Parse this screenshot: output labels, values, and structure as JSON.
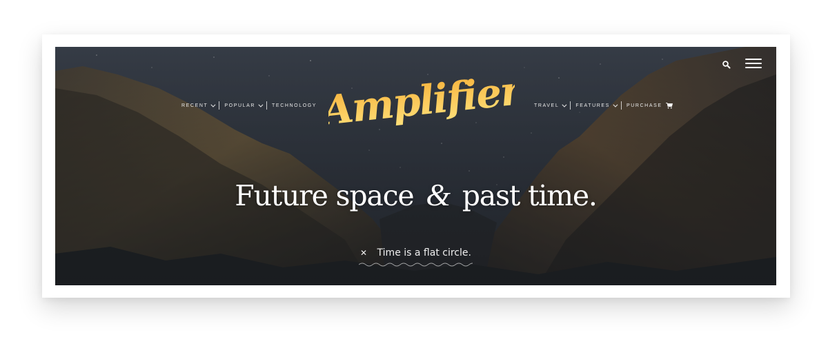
{
  "brand": {
    "logo_text": "Amplifier",
    "colors": {
      "logo_top": "#f6b13a",
      "logo_bottom": "#ffe07a"
    }
  },
  "nav_left": [
    {
      "label": "Recent",
      "dropdown": true
    },
    {
      "label": "Popular",
      "dropdown": true
    },
    {
      "label": "Technology",
      "dropdown": false
    }
  ],
  "nav_right": [
    {
      "label": "Travel",
      "dropdown": true
    },
    {
      "label": "Features",
      "dropdown": true
    },
    {
      "label": "Purchase",
      "icon": "cart-icon"
    }
  ],
  "header_icons": {
    "search": "search-icon",
    "menu": "hamburger-menu-icon"
  },
  "hero": {
    "headline_part1": "Future space",
    "headline_amp": "&",
    "headline_part2": "past time.",
    "tagline": "Time is a flat circle.",
    "close_icon": "close-icon"
  }
}
